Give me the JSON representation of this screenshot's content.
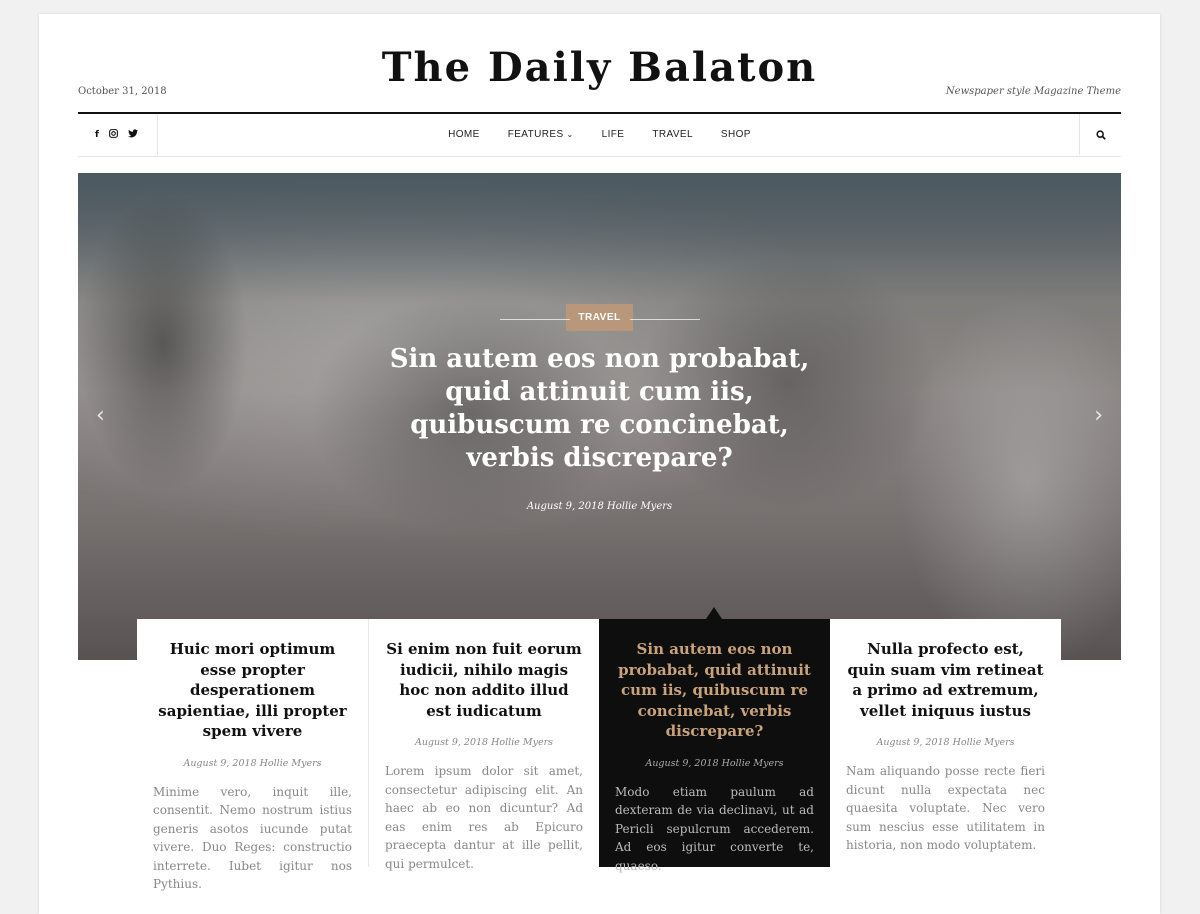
{
  "header": {
    "date": "October 31, 2018",
    "logo": "The Daily Balaton",
    "tagline": "Newspaper style Magazine Theme"
  },
  "social": [
    "facebook-icon",
    "instagram-icon",
    "twitter-icon"
  ],
  "nav": {
    "items": [
      "HOME",
      "FEATURES",
      "LIFE",
      "TRAVEL",
      "SHOP"
    ]
  },
  "hero": {
    "category": "TRAVEL",
    "title": "Sin autem eos non probabat, quid attinuit cum iis, quibuscum re concinebat, verbis discrepare?",
    "meta": "August 9, 2018 Hollie Myers"
  },
  "cards": [
    {
      "title": "Huic mori optimum esse propter desperationem sapientiae, illi propter spem vivere",
      "meta": "August 9, 2018 Hollie Myers",
      "excerpt": "Minime vero, inquit ille, consentit. Nemo nostrum istius generis asotos iucunde putat vivere. Duo Reges: constructio interrete. Iubet igitur nos Pythius."
    },
    {
      "title": "Si enim non fuit eorum iudicii, nihilo magis hoc non addito illud est iudicatum",
      "meta": "August 9, 2018 Hollie Myers",
      "excerpt": "Lorem ipsum dolor sit amet, consectetur adipiscing elit. An haec ab eo non dicuntur? Ad eas enim res ab Epicuro praecepta dantur at ille pellit, qui permulcet."
    },
    {
      "title": "Sin autem eos non probabat, quid attinuit cum iis, quibuscum re concinebat, verbis discrepare?",
      "meta": "August 9, 2018 Hollie Myers",
      "excerpt": "Modo etiam paulum ad dexteram de via declinavi, ut ad Pericli sepulcrum accederem. Ad eos igitur converte te, quaeso."
    },
    {
      "title": "Nulla profecto est, quin suam vim retineat a primo ad extremum, vellet iniquus iustus",
      "meta": "August 9, 2018 Hollie Myers",
      "excerpt": "Nam aliquando posse recte fieri dicunt nulla expectata nec quaesita voluptate. Nec vero sum nescius esse utilitatem in historia, non modo voluptatem."
    }
  ],
  "colors": {
    "accent": "#b8977a",
    "active_card_bg": "#0e0e0e",
    "active_title": "#c8a27a"
  }
}
